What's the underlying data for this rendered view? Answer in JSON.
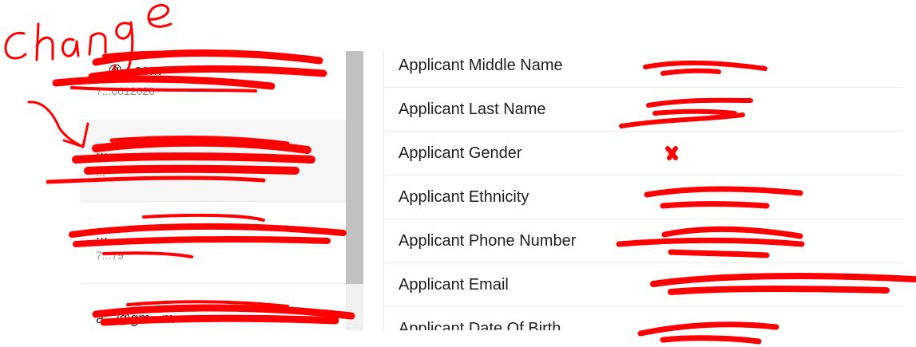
{
  "annotation": {
    "word": "change",
    "color": "#ff0000"
  },
  "left_list": {
    "items": [
      {
        "title": "...@...com",
        "subtitle": "7...0012020"
      },
      {
        "title": "...",
        "subtitle": "..."
      },
      {
        "title": "...",
        "subtitle": "7...79"
      },
      {
        "title": "a...@gm...m",
        "subtitle": ""
      }
    ]
  },
  "details": {
    "rows": [
      {
        "label": "Applicant Middle Name",
        "value": ""
      },
      {
        "label": "Applicant Last Name",
        "value": ""
      },
      {
        "label": "Applicant Gender",
        "value": ""
      },
      {
        "label": "Applicant Ethnicity",
        "value": ""
      },
      {
        "label": "Applicant Phone Number",
        "value": ""
      },
      {
        "label": "Applicant Email",
        "value": ""
      },
      {
        "label": "Applicant Date Of Birth",
        "value": ""
      }
    ]
  },
  "colors": {
    "scrollbar_thumb": "#c1c1c1",
    "redaction": "#ff0000"
  }
}
